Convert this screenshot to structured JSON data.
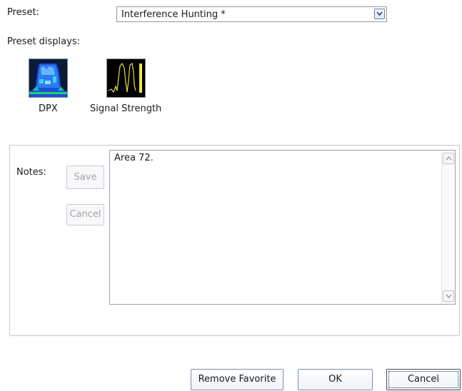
{
  "preset": {
    "label": "Preset:",
    "selected_value": "Interference Hunting *"
  },
  "preset_displays": {
    "label": "Preset displays:",
    "items": [
      {
        "caption": "DPX",
        "icon": "dpx-spectrum-icon"
      },
      {
        "caption": "Signal Strength",
        "icon": "signal-strength-icon"
      }
    ]
  },
  "notes": {
    "label": "Notes:",
    "save_label": "Save",
    "cancel_label": "Cancel",
    "text": "Area 72."
  },
  "footer": {
    "remove_favorite_label": "Remove Favorite",
    "ok_label": "OK",
    "cancel_label": "Cancel"
  }
}
